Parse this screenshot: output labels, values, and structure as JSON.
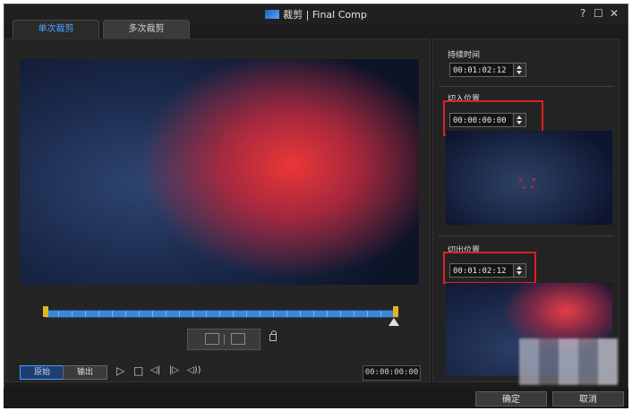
{
  "window": {
    "title": "裁剪 | Final Comp",
    "help_label": "?",
    "maximize_label": "☐",
    "close_label": "✕"
  },
  "tabs": [
    {
      "label": "单次裁剪",
      "active": true
    },
    {
      "label": "多次裁剪",
      "active": false
    }
  ],
  "player": {
    "mode_buttons": {
      "original": "原始",
      "output": "输出"
    },
    "controls": {
      "play": "▷",
      "stop": "□",
      "prev_frame": "◁|",
      "next_frame": "|▷",
      "volume": "◁))"
    },
    "timecode": "00:00:00:00"
  },
  "right_panel": {
    "duration": {
      "label": "持续时间",
      "value": "00:01:02:12"
    },
    "in_point": {
      "label": "切入位置",
      "value": "00:00:00:00"
    },
    "out_point": {
      "label": "切出位置",
      "value": "00:01:02:12"
    }
  },
  "footer": {
    "confirm_label": "确定",
    "cancel_label": "取消"
  },
  "colors": {
    "accent": "#4aa3ff",
    "highlight_box": "#e02020",
    "trim_handle": "#e6b320",
    "timeline": "#3c86d6"
  }
}
